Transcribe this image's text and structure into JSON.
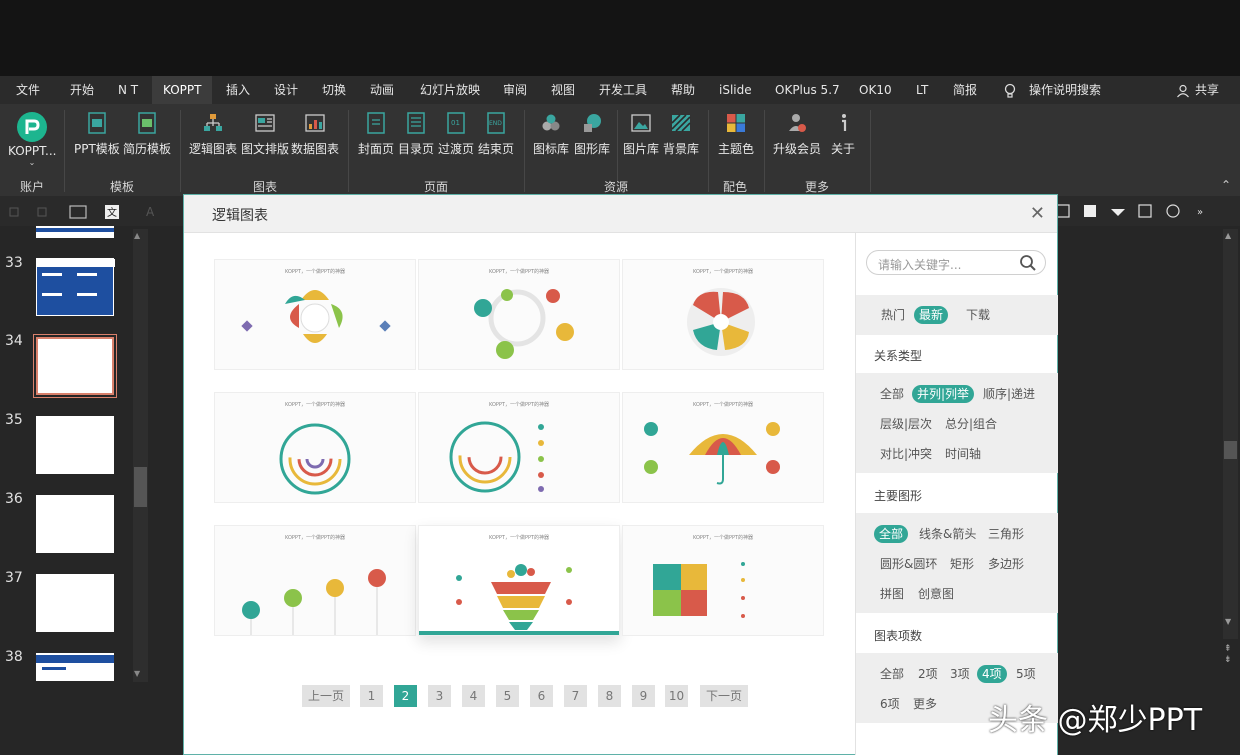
{
  "menu": {
    "items": [
      "文件",
      "开始",
      "N T",
      "KOPPT",
      "插入",
      "设计",
      "切换",
      "动画",
      "幻灯片放映",
      "审阅",
      "视图",
      "开发工具",
      "帮助",
      "iSlide",
      "OKPlus 5.7",
      "OK10",
      "LT",
      "简报"
    ],
    "tell_me": "操作说明搜索",
    "share": "共享"
  },
  "ribbon": {
    "buttons": [
      "KOPPT...",
      "PPT模板",
      "简历模板",
      "逻辑图表",
      "图文排版",
      "数据图表",
      "封面页",
      "目录页",
      "过渡页",
      "结束页",
      "图标库",
      "图形库",
      "图片库",
      "背景库",
      "主题色",
      "升级会员",
      "关于"
    ],
    "groups": [
      "账户",
      "模板",
      "图表",
      "页面",
      "资源",
      "配色",
      "更多"
    ]
  },
  "slides": {
    "numbers": [
      "33",
      "34",
      "35",
      "36",
      "37",
      "38"
    ]
  },
  "dialog": {
    "title": "逻辑图表",
    "card_title": "KOPPT，一个做PPT的神器",
    "pagination": [
      "上一页",
      "1",
      "2",
      "3",
      "4",
      "5",
      "6",
      "7",
      "8",
      "9",
      "10",
      "下一页"
    ],
    "current_page": "2"
  },
  "sidebar": {
    "search_placeholder": "请输入关键字...",
    "sort": [
      "热门",
      "最新",
      "下载"
    ],
    "sort_selected": "最新",
    "relation_title": "关系类型",
    "relation": [
      "全部",
      "并列|列举",
      "顺序|递进",
      "层级|层次",
      "总分|组合",
      "对比|冲突",
      "时间轴"
    ],
    "relation_selected": "并列|列举",
    "shape_title": "主要图形",
    "shapes": [
      "全部",
      "线条&箭头",
      "三角形",
      "圆形&圆环",
      "矩形",
      "多边形",
      "拼图",
      "创意图"
    ],
    "shape_selected": "全部",
    "count_title": "图表项数",
    "counts": [
      "全部",
      "2项",
      "3项",
      "4项",
      "5项",
      "6项",
      "更多"
    ],
    "count_selected": "4项"
  },
  "watermark": "头条 @郑少PPT",
  "colors": {
    "accent": "#31a696",
    "menu_bg": "#2b2b2b",
    "ribbon_bg": "#333333"
  }
}
